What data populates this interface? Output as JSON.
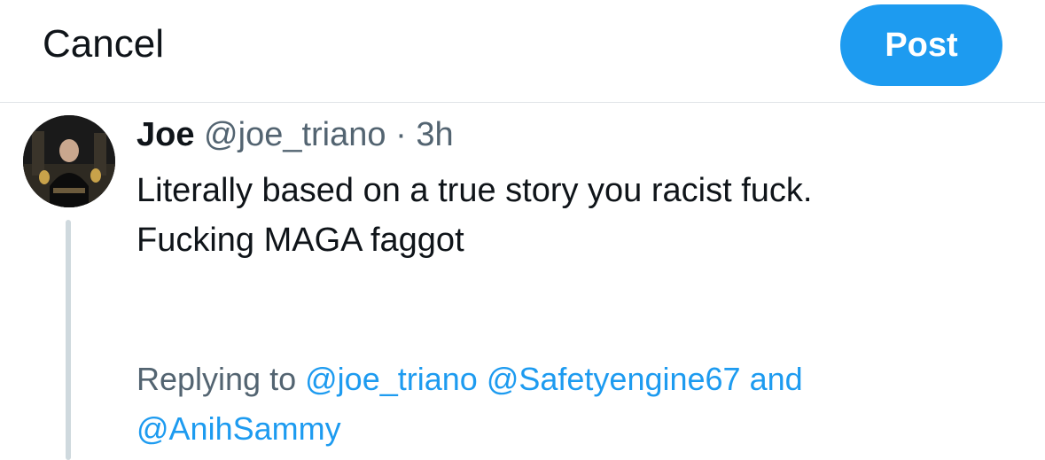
{
  "header": {
    "cancel_label": "Cancel",
    "post_label": "Post",
    "post_color": "#1d9bf0"
  },
  "tweet": {
    "name": "Joe",
    "handle": "@joe_triano",
    "separator": "·",
    "time": "3h",
    "text_lines": [
      "Literally based on a true story you racist fuck.",
      "Fucking MAGA faggot"
    ]
  },
  "replying": {
    "prefix": "Replying to",
    "mentions": [
      "@joe_triano",
      "@Safetyengine67",
      "@AnihSammy"
    ],
    "conjunction": "and"
  },
  "colors": {
    "text": "#0f1419",
    "muted": "#536471",
    "link": "#1d9bf0",
    "divider": "#e1e4e8",
    "thread_line": "#cfd9de"
  }
}
